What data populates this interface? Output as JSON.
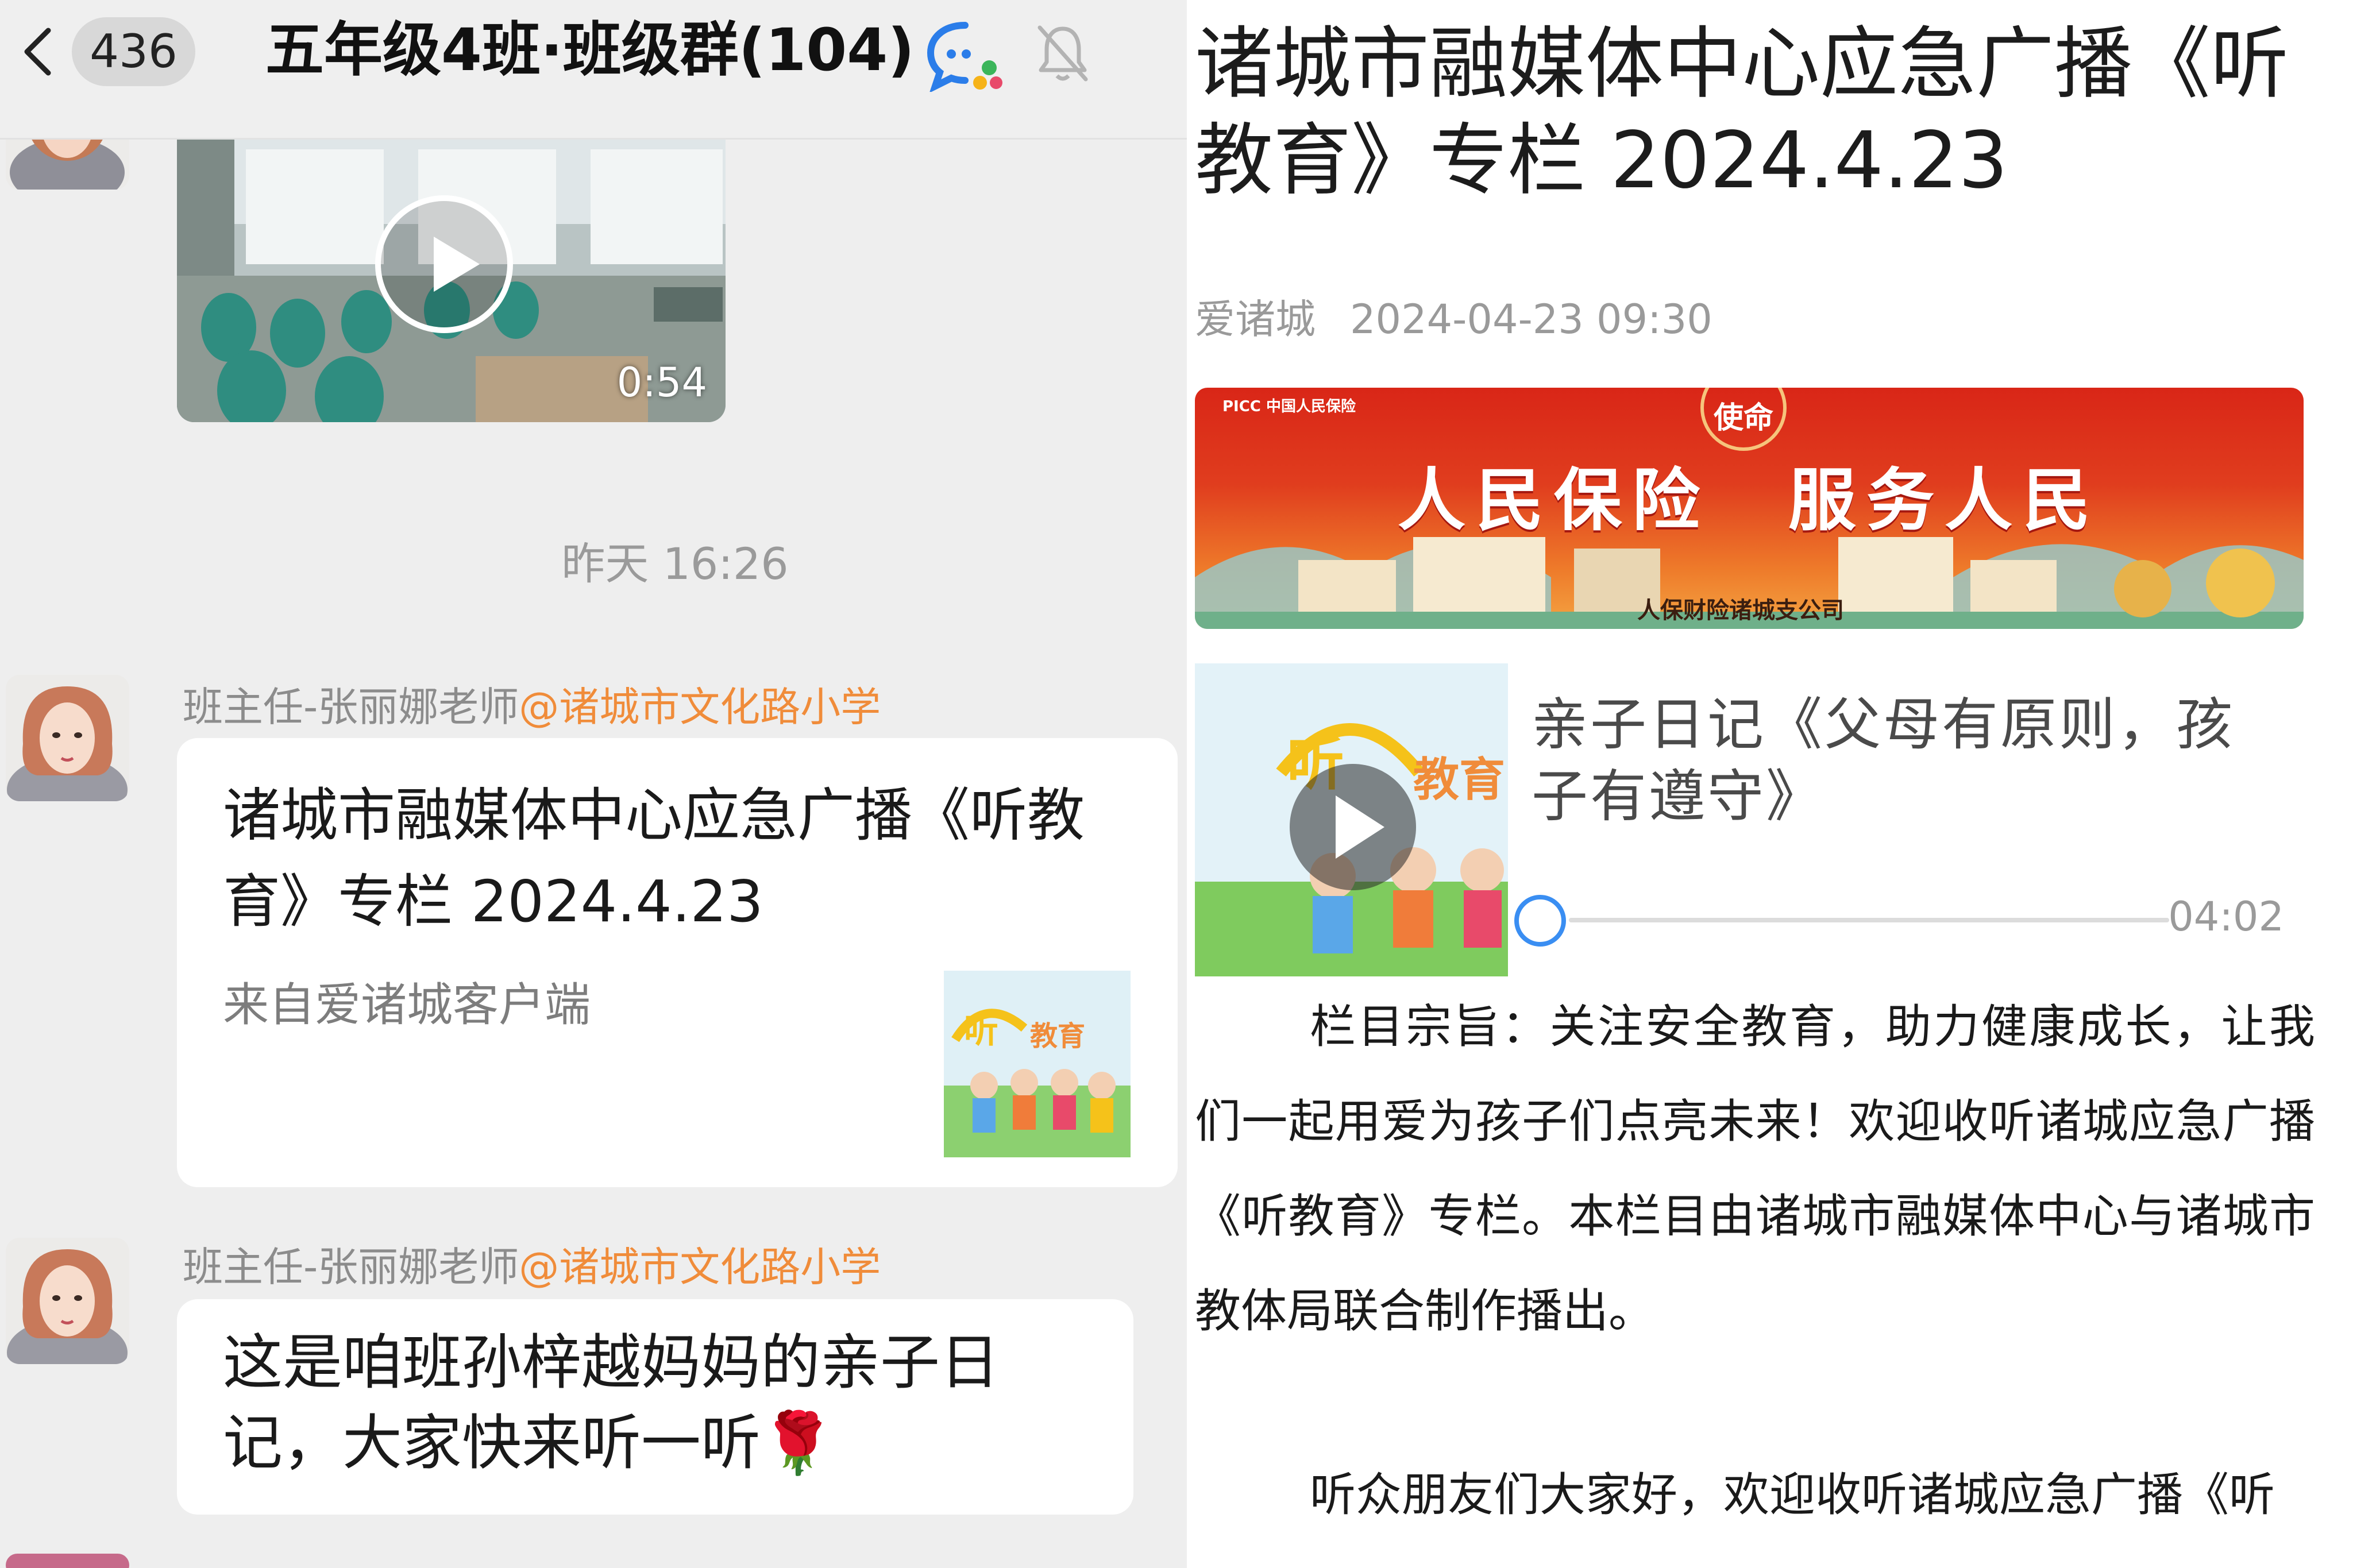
{
  "chat": {
    "back_icon": "chevron-left-icon",
    "unread_count": "436",
    "group_title": "五年级4班·班级群(104)",
    "chat_icon": "group-chat-icon",
    "mute_icon": "bell-muted-icon",
    "video": {
      "duration": "0:54"
    },
    "timestamp": "昨天 16:26",
    "messages": [
      {
        "sender_name": "班主任-张丽娜老师",
        "sender_org": "@诸城市文化路小学",
        "card_title": "诸城市融媒体中心应急广播《听教育》专栏 2024.4.23",
        "card_source": "来自爱诸城客户端"
      },
      {
        "sender_name": "班主任-张丽娜老师",
        "sender_org": "@诸城市文化路小学",
        "text": "这是咱班孙梓越妈妈的亲子日记，大家快来听一听🌹"
      }
    ]
  },
  "article": {
    "title": "诸城市融媒体中心应急广播《听教育》专栏 2024.4.23",
    "source": "爱诸城",
    "date": "2024-04-23 09:30",
    "banner": {
      "logo": "PICC 中国人民保险",
      "badge": "使命",
      "slogan": "人民保险　服务人民",
      "company": "人保财险诸城支公司"
    },
    "audio": {
      "title": "亲子日记《父母有原则，孩子有遵守》",
      "duration": "04:02",
      "progress": 0
    },
    "paragraphs": [
      "栏目宗旨：关注安全教育，助力健康成长，让我们一起用爱为孩子们点亮未来！欢迎收听诸城应急广播《听教育》专栏。本栏目由诸城市融媒体中心与诸城市教体局联合制作播出。",
      "听众朋友们大家好，欢迎收听诸城应急广播《听"
    ]
  },
  "colors": {
    "accent_orange": "#f08c3a",
    "progress_blue": "#3a8ef2",
    "banner_red": "#d92617"
  }
}
